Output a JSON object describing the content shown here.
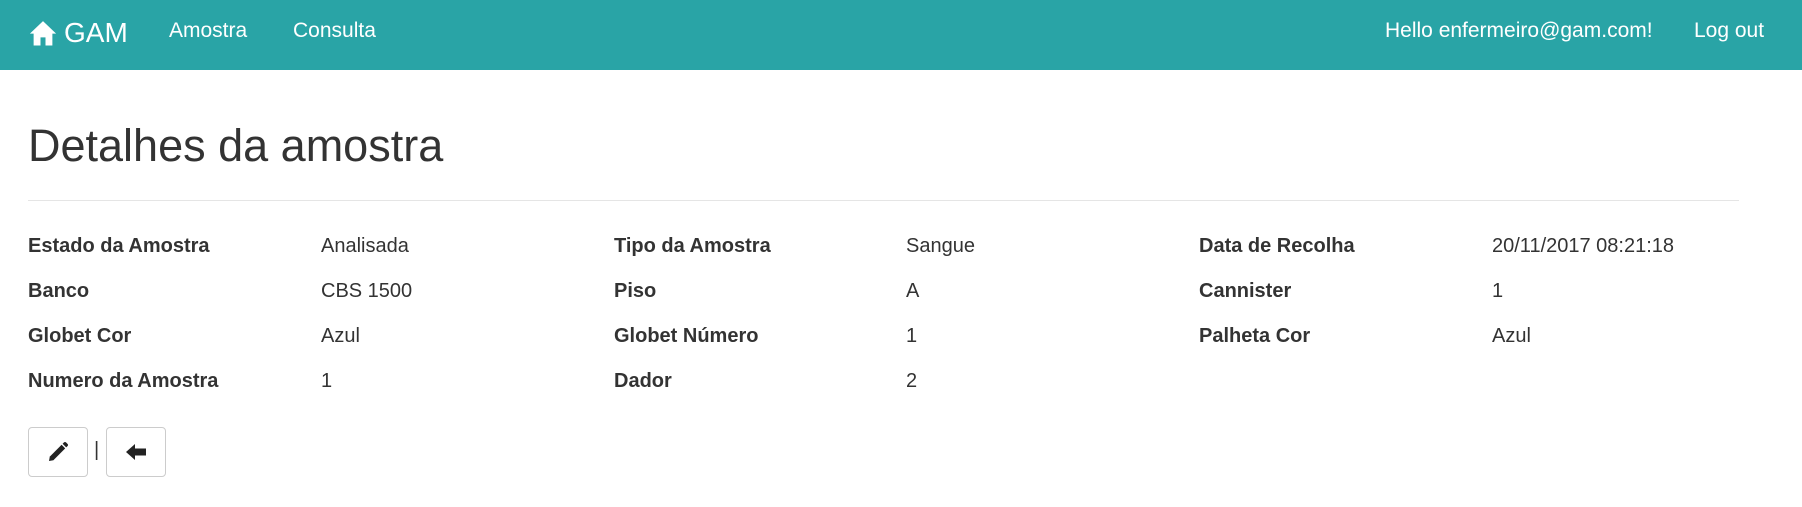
{
  "navbar": {
    "brand_label": "GAM",
    "brand_icon": "home-icon",
    "links": {
      "amostra": "Amostra",
      "consulta": "Consulta"
    },
    "greeting": "Hello enfermeiro@gam.com!",
    "logout": "Log out",
    "color": "#29a4a6"
  },
  "page": {
    "title": "Detalhes da amostra"
  },
  "details": {
    "estado_label": "Estado da Amostra",
    "estado_value": "Analisada",
    "tipo_label": "Tipo da Amostra",
    "tipo_value": "Sangue",
    "data_label": "Data de Recolha",
    "data_value": "20/11/2017 08:21:18",
    "banco_label": "Banco",
    "banco_value": "CBS 1500",
    "piso_label": "Piso",
    "piso_value": "A",
    "cannister_label": "Cannister",
    "cannister_value": "1",
    "globet_cor_label": "Globet Cor",
    "globet_cor_value": "Azul",
    "globet_numero_label": "Globet Número",
    "globet_numero_value": "1",
    "palheta_cor_label": "Palheta Cor",
    "palheta_cor_value": "Azul",
    "numero_label": "Numero da Amostra",
    "numero_value": "1",
    "dador_label": "Dador",
    "dador_value": "2"
  },
  "actions": {
    "edit_icon": "pencil-icon",
    "separator": "|",
    "back_icon": "arrow-left-icon"
  }
}
